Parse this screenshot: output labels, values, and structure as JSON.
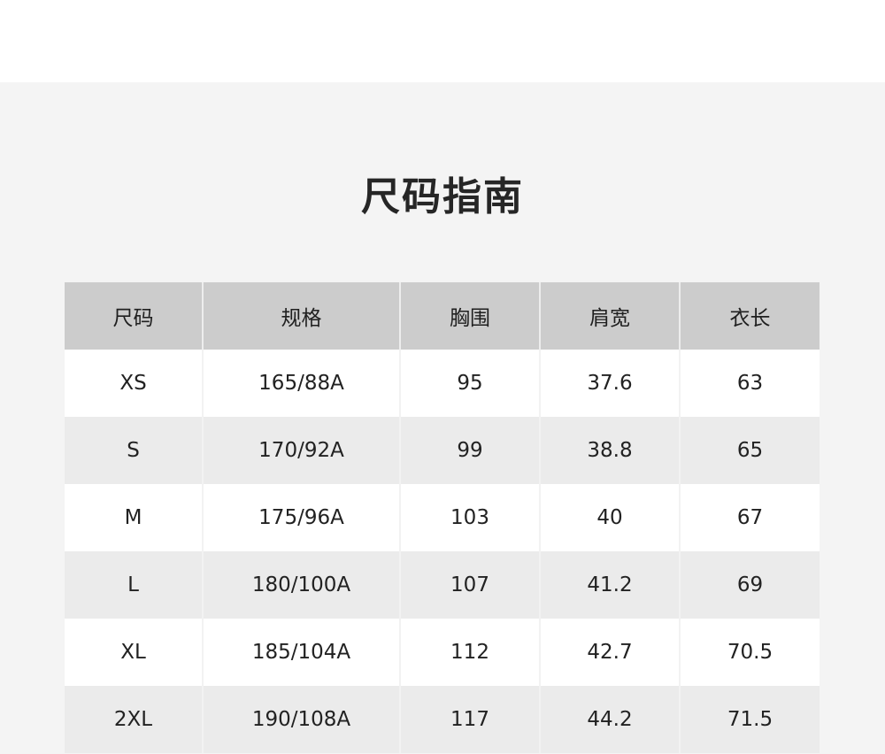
{
  "title": "尺码指南",
  "table": {
    "headers": [
      "尺码",
      "规格",
      "胸围",
      "肩宽",
      "衣长"
    ],
    "rows": [
      [
        "XS",
        "165/88A",
        "95",
        "37.6",
        "63"
      ],
      [
        "S",
        "170/92A",
        "99",
        "38.8",
        "65"
      ],
      [
        "M",
        "175/96A",
        "103",
        "40",
        "67"
      ],
      [
        "L",
        "180/100A",
        "107",
        "41.2",
        "69"
      ],
      [
        "XL",
        "185/104A",
        "112",
        "42.7",
        "70.5"
      ],
      [
        "2XL",
        "190/108A",
        "117",
        "44.2",
        "71.5"
      ]
    ]
  }
}
